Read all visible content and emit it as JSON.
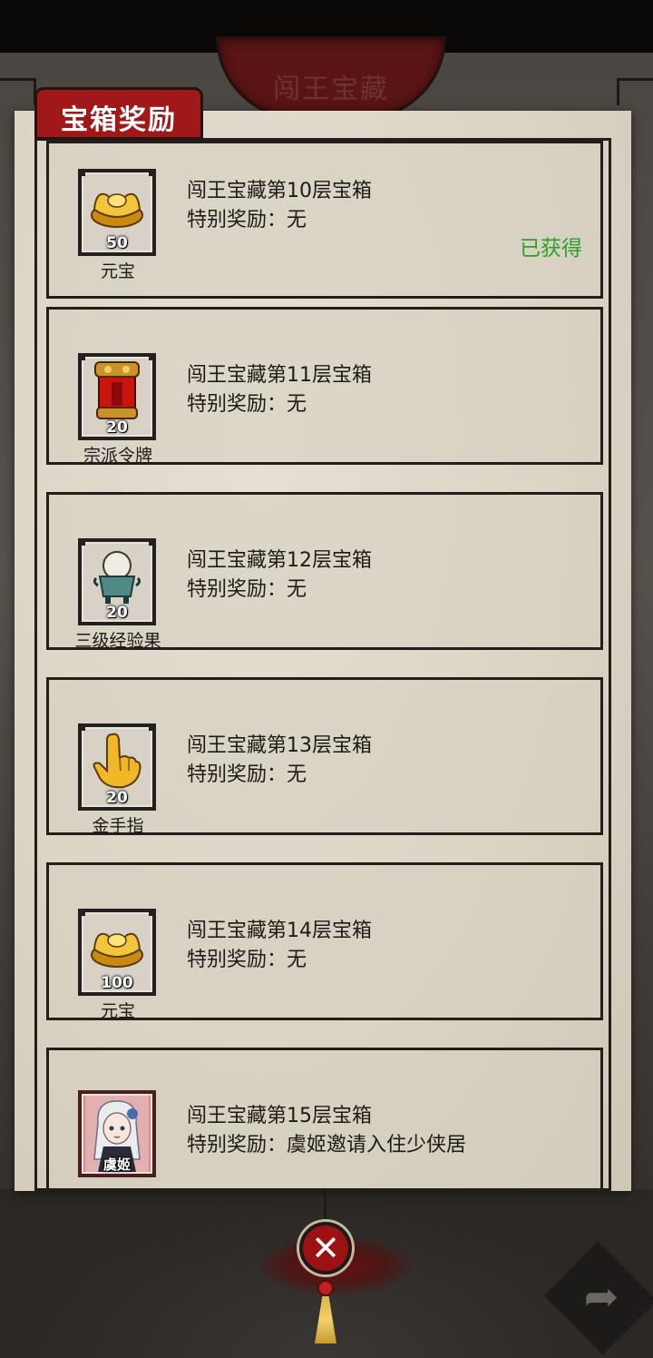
{
  "header": {
    "title": "闯王宝藏",
    "tab_label": "宝箱奖励"
  },
  "rewards": [
    {
      "title": "闯王宝藏第10层宝箱",
      "special": "特别奖励：无",
      "item_name": "元宝",
      "item_count": "50",
      "item_icon": "gold-ingot-icon",
      "status": "已获得"
    },
    {
      "title": "闯王宝藏第11层宝箱",
      "special": "特别奖励：无",
      "item_name": "宗派令牌",
      "item_count": "20",
      "item_icon": "sect-token-icon",
      "status": ""
    },
    {
      "title": "闯王宝藏第12层宝箱",
      "special": "特别奖励：无",
      "item_name": "三级经验果",
      "item_count": "20",
      "item_icon": "experience-fruit-icon",
      "status": ""
    },
    {
      "title": "闯王宝藏第13层宝箱",
      "special": "特别奖励：无",
      "item_name": "金手指",
      "item_count": "20",
      "item_icon": "golden-finger-icon",
      "status": ""
    },
    {
      "title": "闯王宝藏第14层宝箱",
      "special": "特别奖励：无",
      "item_name": "元宝",
      "item_count": "100",
      "item_icon": "gold-ingot-icon",
      "status": ""
    },
    {
      "title": "闯王宝藏第15层宝箱",
      "special": "特别奖励：虞姬邀请入住少侠居",
      "item_name": "虞姬",
      "item_count": "",
      "item_icon": "character-portrait-icon",
      "status": ""
    }
  ],
  "colors": {
    "accent_red": "#a01818",
    "status_green": "#2ea02a",
    "paper": "#dcd5c6"
  }
}
